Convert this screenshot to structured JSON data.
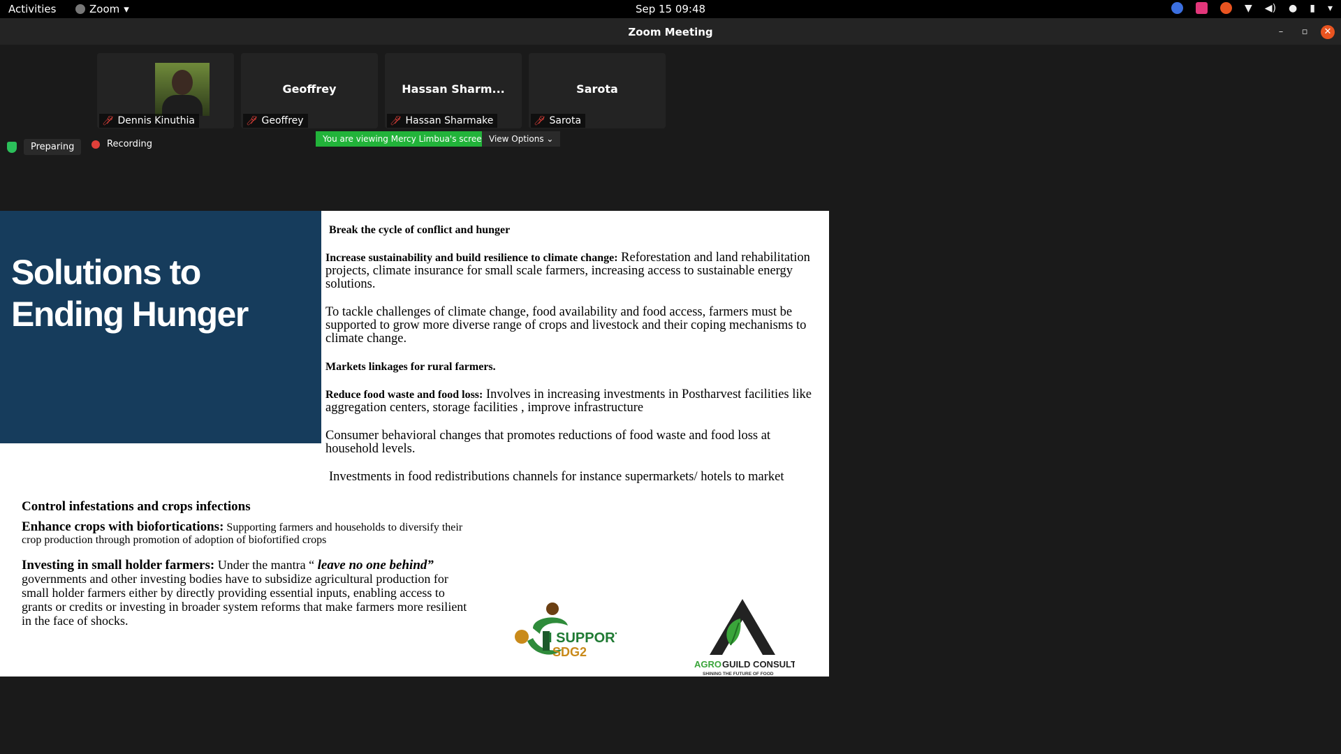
{
  "topbar": {
    "activities": "Activities",
    "app_name": "Zoom",
    "clock": "Sep 15  09:48",
    "tray": {
      "accent_blue": "#3b6fe0",
      "accent_pink": "#e2367a",
      "accent_orange": "#e95420"
    }
  },
  "window": {
    "title": "Zoom Meeting",
    "minimize": "–",
    "restore": "▫",
    "close": "✕"
  },
  "participants": [
    {
      "big_name": "",
      "name": "Dennis Kinuthia",
      "muted": true,
      "has_video": true
    },
    {
      "big_name": "Geoffrey",
      "name": "Geoffrey",
      "muted": true,
      "has_video": false
    },
    {
      "big_name": "Hassan Sharm...",
      "name": "Hassan Sharmake",
      "muted": true,
      "has_video": false
    },
    {
      "big_name": "Sarota",
      "name": "Sarota",
      "muted": true,
      "has_video": false
    }
  ],
  "status": {
    "preparing": "Preparing",
    "recording": "Recording"
  },
  "share": {
    "banner": "You are viewing Mercy Limbua's screen",
    "view_options": "View Options",
    "banner_color": "#22b33a"
  },
  "slide": {
    "title": "Solutions to Ending Hunger",
    "right": {
      "p1": "Break the cycle of conflict and hunger",
      "p2_bold": "Increase sustainability and build resilience to climate change:",
      "p2_text": " Reforestation and land rehabilitation projects, climate insurance for small scale farmers, increasing access to sustainable energy solutions.",
      "p3": "To tackle challenges of climate change, food availability and food access, farmers must be supported to grow more diverse range of crops and livestock and their coping mechanisms to climate change.",
      "p4": "Markets linkages for rural farmers.",
      "p5_bold": "Reduce food waste and food loss:",
      "p5_text": " Involves in increasing investments in Postharvest facilities like aggregation centers, storage facilities , improve infrastructure",
      "p6": "Consumer behavioral  changes  that promotes reductions of food waste and food loss at household levels.",
      "p7": " Investments in food redistributions channels for instance supermarkets/ hotels to market"
    },
    "left": {
      "h1": "Control infestations and crops infections",
      "p1_bold": "Enhance crops with biofortications:",
      "p1_text": " Supporting farmers and households to diversify their crop production through promotion of adoption of biofortified crops",
      "p2_bold": "Investing in small holder farmers:",
      "p2_text1": " Under the mantra “ ",
      "p2_italic": "leave no one behind”",
      "p2_text2": " governments and other investing bodies have to subsidize agricultural production  for small holder farmers either by directly providing essential inputs, enabling access to grants or credits or investing in broader system reforms that make farmers more resilient in the face of shocks."
    },
    "logos": {
      "sdg_line1": "I SUPPORT",
      "sdg_line2": "SDG2",
      "agro_name_a": "AGRO",
      "agro_name_b": "GUILD CONSULTANCY",
      "agro_tagline": "SHINING THE FUTURE OF FOOD"
    }
  }
}
